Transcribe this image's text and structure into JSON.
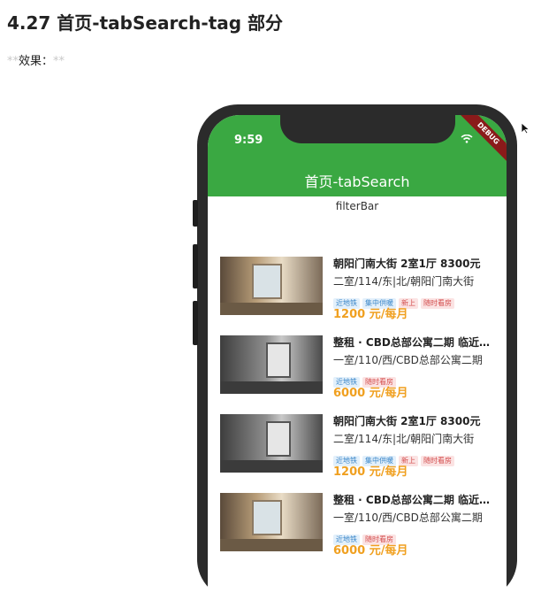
{
  "doc": {
    "title": "4.27 首页-tabSearch-tag 部分",
    "effect_label": "效果：",
    "effect_mark": "**"
  },
  "phone": {
    "time": "9:59",
    "debug": "DEBUG",
    "appbar_title": "首页-tabSearch",
    "filterbar": "filterBar"
  },
  "listings": [
    {
      "title": "朝阳门南大街 2室1厅 8300元",
      "subtitle": "二室/114/东|北/朝阳门南大街",
      "tags": [
        "近地铁",
        "集中供暖",
        "新上",
        "随时看房"
      ],
      "price": "1200 元/每月"
    },
    {
      "title": "整租 · CBD总部公寓二期 临近国...",
      "subtitle": "一室/110/西/CBD总部公寓二期",
      "tags": [
        "近地铁",
        "随时看房"
      ],
      "price": "6000 元/每月"
    },
    {
      "title": "朝阳门南大街 2室1厅 8300元",
      "subtitle": "二室/114/东|北/朝阳门南大街",
      "tags": [
        "近地铁",
        "集中供暖",
        "新上",
        "随时看房"
      ],
      "price": "1200 元/每月"
    },
    {
      "title": "整租 · CBD总部公寓二期 临近国...",
      "subtitle": "一室/110/西/CBD总部公寓二期",
      "tags": [
        "近地铁",
        "随时看房"
      ],
      "price": "6000 元/每月"
    }
  ],
  "colors": {
    "appbar": "#3aa842",
    "price": "#f0a020",
    "tag_blue": "#3a86c8",
    "tag_red": "#d34e4e"
  }
}
